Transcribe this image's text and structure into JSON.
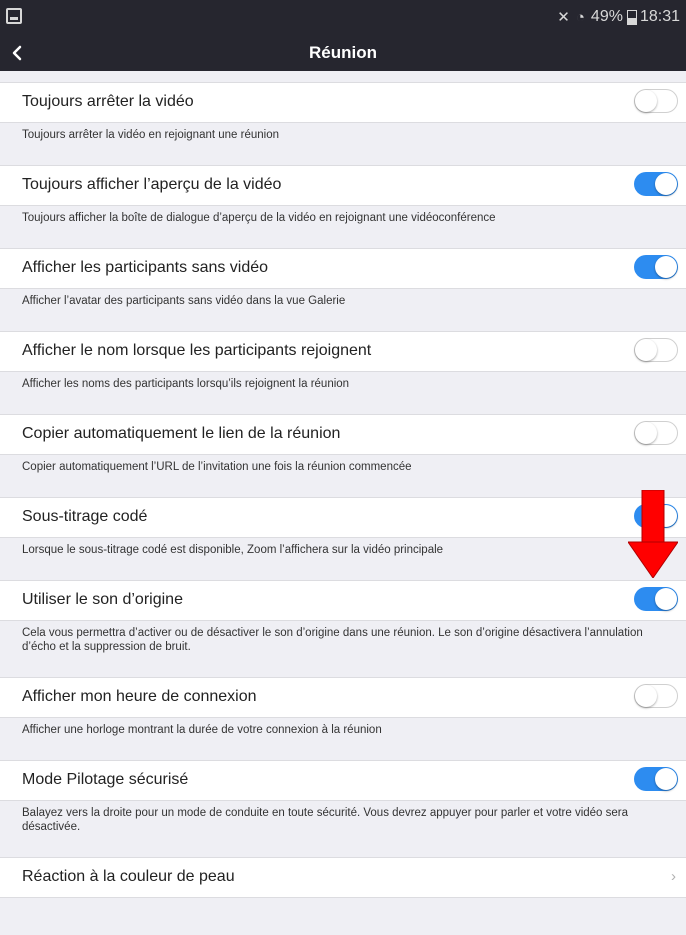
{
  "status_bar": {
    "battery": "49%",
    "time": "18:31",
    "icons": [
      "gallery-icon",
      "mute-icon",
      "wifi-icon",
      "battery-icon"
    ]
  },
  "nav": {
    "title": "Réunion",
    "back_icon": "chevron-left-icon"
  },
  "settings": [
    {
      "label": "Toujours arrêter la vidéo",
      "description": "Toujours arrêter la vidéo en rejoignant une réunion",
      "enabled": false
    },
    {
      "label": "Toujours afficher l’aperçu de la vidéo",
      "description": "Toujours afficher la boîte de dialogue d’aperçu de la vidéo en rejoignant une vidéoconférence",
      "enabled": true
    },
    {
      "label": "Afficher les participants sans vidéo",
      "description": "Afficher l’avatar des participants sans vidéo dans la vue Galerie",
      "enabled": true
    },
    {
      "label": "Afficher le nom lorsque les participants rejoignent",
      "description": "Afficher les noms des participants lorsqu’ils rejoignent la réunion",
      "enabled": false
    },
    {
      "label": "Copier automatiquement le lien de la réunion",
      "description": "Copier automatiquement l’URL de l’invitation une fois la réunion commencée",
      "enabled": false
    },
    {
      "label": "Sous-titrage codé",
      "description": "Lorsque le sous-titrage codé est disponible, Zoom l’affichera sur la vidéo principale",
      "enabled": true
    },
    {
      "label": "Utiliser le son d’origine",
      "description": "Cela vous permettra d’activer ou de désactiver le son d’origine dans une réunion. Le son d’origine désactivera l’annulation d’écho et la suppression de bruit.",
      "enabled": true
    },
    {
      "label": "Afficher mon heure de connexion",
      "description": "Afficher une horloge montrant la durée de votre connexion à la réunion",
      "enabled": false
    },
    {
      "label": "Mode Pilotage sécurisé",
      "description": "Balayez vers la droite pour un mode de conduite en toute sécurité. Vous devrez appuyer pour parler et votre vidéo sera désactivée.",
      "enabled": true
    }
  ],
  "last_item": {
    "label": "Réaction à la couleur de peau"
  },
  "colors": {
    "accent": "#2d8cf0",
    "header": "#26262f",
    "annotation_arrow": "#ff0000"
  }
}
